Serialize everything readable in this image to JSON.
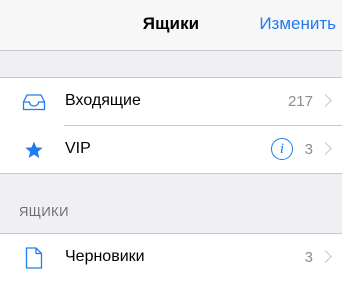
{
  "navbar": {
    "title": "Ящики",
    "edit_label": "Изменить"
  },
  "main_group": {
    "items": [
      {
        "label": "Входящие",
        "count": "217",
        "icon": "inbox-tray-icon"
      },
      {
        "label": "VIP",
        "count": "3",
        "icon": "star-icon",
        "info_icon": "info-icon"
      }
    ]
  },
  "mailboxes_section": {
    "header": "ЯЩИКИ",
    "items": [
      {
        "label": "Черновики",
        "count": "3",
        "icon": "document-icon"
      }
    ]
  },
  "colors": {
    "accent": "#1f7cf3",
    "secondary_text": "#8e8e93",
    "separator": "#c8c7cc",
    "group_background": "#efeff4"
  }
}
